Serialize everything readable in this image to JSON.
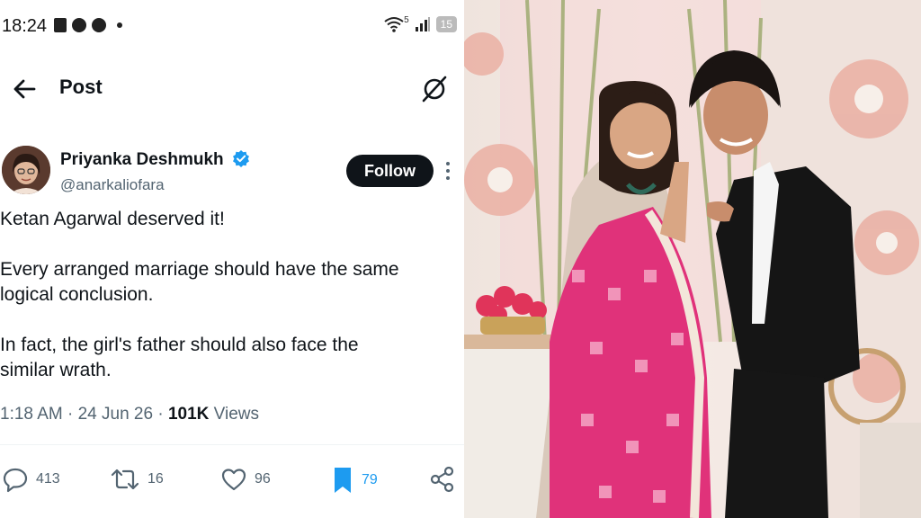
{
  "status_bar": {
    "time": "18:24",
    "network": "5",
    "battery": "15"
  },
  "header": {
    "title": "Post"
  },
  "author": {
    "name": "Priyanka Deshmukh",
    "handle": "@anarkaliofara"
  },
  "follow_label": "Follow",
  "tweet": {
    "paragraphs": [
      "Ketan Agarwal deserved it!",
      "Every arranged marriage should have the same\nlogical conclusion.",
      "In fact, the girl's father should also face the\nsimilar wrath."
    ]
  },
  "meta": {
    "time": "1:18 AM",
    "date": "24 Jun 26",
    "views_count": "101K",
    "views_label": "Views"
  },
  "actions": {
    "replies": "413",
    "reposts": "16",
    "likes": "96",
    "bookmarks": "79"
  },
  "colors": {
    "accent": "#1d9bf0",
    "text": "#0f1419",
    "muted": "#536471"
  }
}
